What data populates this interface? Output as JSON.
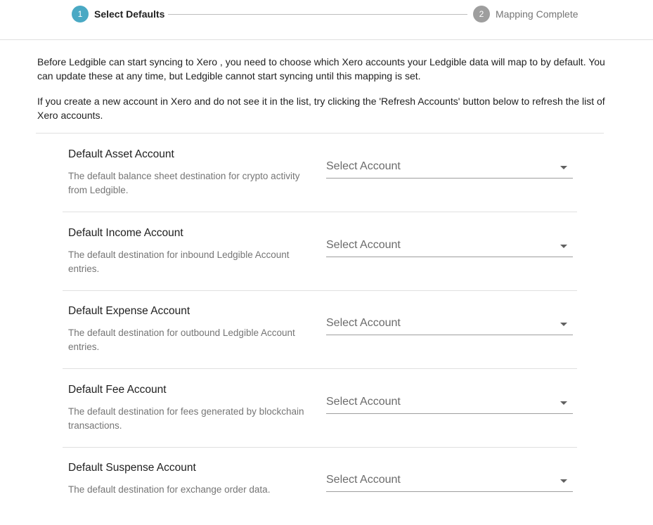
{
  "stepper": {
    "step1": {
      "number": "1",
      "label": "Select Defaults"
    },
    "step2": {
      "number": "2",
      "label": "Mapping Complete"
    }
  },
  "intro": {
    "paragraph1": "Before Ledgible can start syncing to  Xero , you need to choose which Xero accounts your Ledgible data will map to by default. You can update these at any time, but Ledgible cannot start syncing until this mapping is set.",
    "paragraph2": "If you create a new account in Xero and do not see it in the list, try clicking the 'Refresh Accounts' button below to refresh the list of Xero accounts."
  },
  "accounts": [
    {
      "title": "Default Asset Account",
      "description": "The default balance sheet destination for crypto activity from Ledgible.",
      "placeholder": "Select Account"
    },
    {
      "title": "Default Income Account",
      "description": "The default destination for inbound Ledgible Account entries.",
      "placeholder": "Select Account"
    },
    {
      "title": "Default Expense Account",
      "description": "The default destination for outbound Ledgible Account entries.",
      "placeholder": "Select Account"
    },
    {
      "title": "Default Fee Account",
      "description": "The default destination for fees generated by blockchain transactions.",
      "placeholder": "Select Account"
    },
    {
      "title": "Default Suspense Account",
      "description": "The default destination for exchange order data.",
      "placeholder": "Select Account"
    }
  ],
  "colors": {
    "active_step": "#4aa9c4",
    "inactive_step": "#9e9e9e"
  },
  "icons": {
    "select_arrow": "caret-down-icon"
  }
}
